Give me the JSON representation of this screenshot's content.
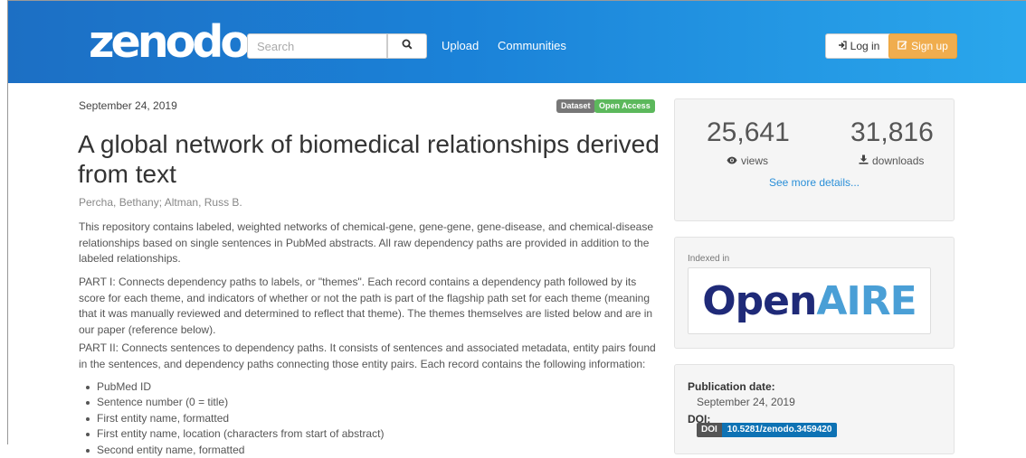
{
  "header": {
    "logo": "zenodo",
    "search": {
      "placeholder": "Search",
      "value": ""
    },
    "search_icon": "search-icon",
    "nav": [
      {
        "label": "Upload"
      },
      {
        "label": "Communities"
      }
    ],
    "login_label": "Log in",
    "login_icon": "sign-in-icon",
    "signup_label": "Sign up",
    "signup_icon": "edit-icon"
  },
  "record": {
    "publication_date": "September 24, 2019",
    "badges": {
      "type": "Dataset",
      "access": "Open Access"
    },
    "title": "A global network of biomedical relationships derived from text",
    "authors": "Percha, Bethany; Altman, Russ B.",
    "paragraphs": [
      "This repository contains labeled, weighted networks of chemical-gene, gene-gene, gene-disease, and chemical-disease relationships based on single sentences in PubMed abstracts. All raw dependency paths are provided in addition to the labeled relationships.",
      "PART I: Connects dependency paths to labels, or \"themes\". Each record contains a dependency path followed by its score for each theme, and indicators of whether or not the path is part of the flagship path set for each theme (meaning that it was manually reviewed and determined to reflect that theme). The themes themselves are listed below and are in our paper (reference below).",
      "PART II: Connects sentences to dependency paths. It consists of sentences and associated metadata, entity pairs found in the sentences, and dependency paths connecting those entity pairs. Each record contains the following information:"
    ],
    "bullets": [
      "PubMed ID",
      "Sentence number (0 = title)",
      "First entity name, formatted",
      "First entity name, location (characters from start of abstract)",
      "Second entity name, formatted"
    ]
  },
  "stats": {
    "views": {
      "count": "25,641",
      "label": "views",
      "icon": "eye-icon"
    },
    "downloads": {
      "count": "31,816",
      "label": "downloads",
      "icon": "download-icon"
    },
    "see_more": "See more details..."
  },
  "indexed": {
    "label": "Indexed in",
    "logo_open": "Open",
    "logo_aire": "AIRE"
  },
  "metadata": {
    "publication_date_label": "Publication date:",
    "publication_date": "September 24, 2019",
    "doi_label": "DOI:",
    "doi_tag": "DOI",
    "doi_value": "10.5281/zenodo.3459420"
  },
  "colors": {
    "header_start": "#1c6fc4",
    "header_end": "#2aa7ec",
    "signup": "#f0ad4e",
    "open_access": "#5cb85c",
    "doi": "#0e72b4",
    "link": "#2a8fd8"
  }
}
